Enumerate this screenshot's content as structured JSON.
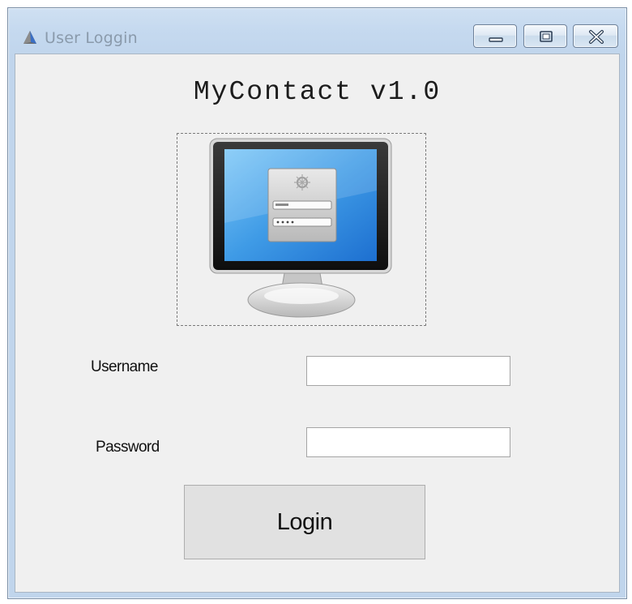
{
  "window": {
    "title": "User Loggin",
    "icon": "app-logo-icon",
    "controls": {
      "minimize_icon": "minimize-icon",
      "maximize_icon": "maximize-icon",
      "close_icon": "close-icon"
    }
  },
  "form": {
    "heading": "MyContact v1.0",
    "picture_icon": "monitor-login-icon",
    "username_label": "Username",
    "username_value": "",
    "password_label": "Password",
    "password_value": "",
    "login_label": "Login"
  },
  "colors": {
    "titlebar": "#c5d9ef",
    "client_background": "#f0f0f0",
    "button_background": "#e1e1e1",
    "screen_blue": "#3f9be6"
  }
}
